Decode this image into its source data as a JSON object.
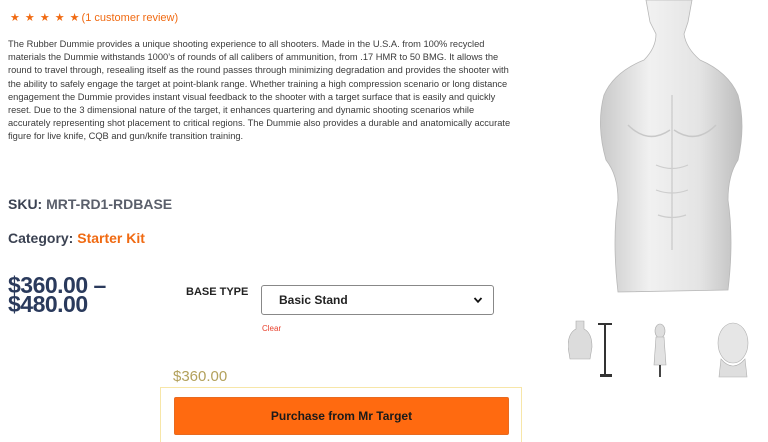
{
  "product": {
    "rating": {
      "stars": "★ ★ ★ ★ ★",
      "review_link": "(1 customer review)"
    },
    "description": "The Rubber Dummie provides a unique shooting experience to all shooters. Made in the U.S.A. from 100% recycled materials the Dummie withstands 1000’s of rounds of all calibers of ammunition, from .17 HMR to 50 BMG. It allows the round to travel through, resealing itself as the round passes through minimizing degradation and provides the shooter with the ability to safely engage the target at point-blank range. Whether training a high compression scenario or long distance engagement the Dummie provides instant visual feedback to the shooter with a target surface that is easily and quickly reset. Due to the 3 dimensional nature of the target, it enhances quartering and dynamic shooting scenarios while accurately representing shot placement to critical regions. The Dummie also provides a durable and anatomically accurate figure for live knife, CQB and gun/knife transition training.",
    "sku_label": "SKU:",
    "sku_value": "MRT-RD1-RDBASE",
    "category_label": "Category:",
    "category_value": "Starter Kit",
    "price_range_low": "$360.00 –",
    "price_range_high": "$480.00"
  },
  "variation": {
    "label": "BASE TYPE",
    "selected": "Basic Stand",
    "clear_label": "Clear",
    "selected_price": "$360.00"
  },
  "purchase": {
    "button_label": "Purchase from Mr Target"
  },
  "colors": {
    "accent": "#ff6a10",
    "link": "#f06a12",
    "price": "#2a3a5c"
  }
}
